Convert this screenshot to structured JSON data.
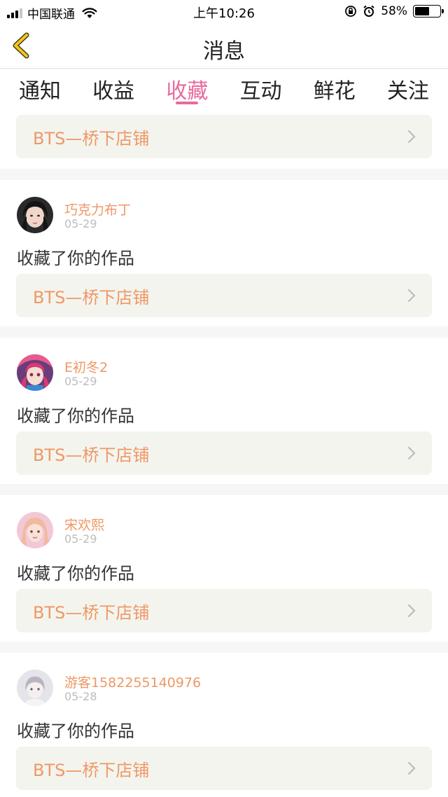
{
  "status_bar": {
    "carrier": "中国联通",
    "time": "上午10:26",
    "battery": "58%",
    "battery_level": 0.58
  },
  "navbar": {
    "title": "消息",
    "back_icon": "chevron-left-icon",
    "accent": "#f5c518"
  },
  "tabs": [
    {
      "label": "通知",
      "active": false
    },
    {
      "label": "收益",
      "active": false
    },
    {
      "label": "收藏",
      "active": true
    },
    {
      "label": "互动",
      "active": false
    },
    {
      "label": "鲜花",
      "active": false
    },
    {
      "label": "关注",
      "active": false
    }
  ],
  "colors": {
    "active_tab": "#e86a9e",
    "name": "#ee9866",
    "link_bg": "#f4f4ee"
  },
  "first_item": {
    "work_title": "BTS—桥下店铺"
  },
  "messages": [
    {
      "user": "巧克力布丁",
      "date": "05-29",
      "action": "收藏了你的作品",
      "work_title": "BTS—桥下店铺"
    },
    {
      "user": "E初冬2",
      "date": "05-29",
      "action": "收藏了你的作品",
      "work_title": "BTS—桥下店铺"
    },
    {
      "user": "宋欢熙",
      "date": "05-29",
      "action": "收藏了你的作品",
      "work_title": "BTS—桥下店铺"
    },
    {
      "user": "游客1582255140976",
      "date": "05-28",
      "action": "收藏了你的作品",
      "work_title": "BTS—桥下店铺"
    }
  ]
}
